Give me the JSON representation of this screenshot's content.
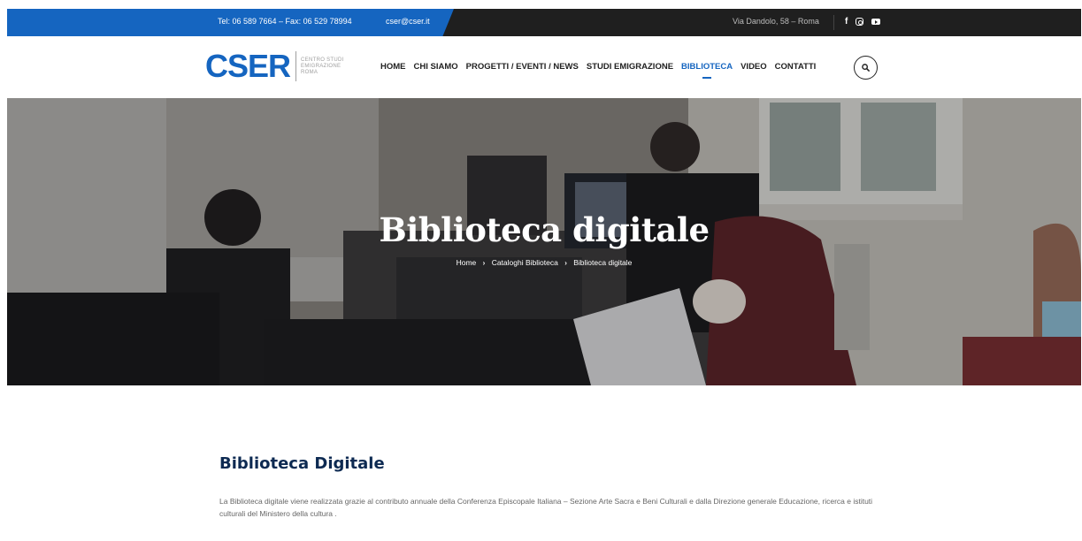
{
  "topbar": {
    "phone": "Tel: 06 589 7664 – Fax: 06 529 78994",
    "email": "cser@cser.it",
    "address": "Via Dandolo, 58 – Roma",
    "social": [
      "facebook-icon",
      "instagram-icon",
      "youtube-icon"
    ]
  },
  "logo": {
    "main": "CSER",
    "line1": "CENTRO STUDI",
    "line2": "EMIGRAZIONE",
    "line3": "ROMA"
  },
  "nav": {
    "items": [
      {
        "label": "HOME"
      },
      {
        "label": "CHI SIAMO"
      },
      {
        "label": "PROGETTI / EVENTI / NEWS"
      },
      {
        "label": "STUDI EMIGRAZIONE"
      },
      {
        "label": "BIBLIOTECA",
        "active": true
      },
      {
        "label": "VIDEO"
      },
      {
        "label": "CONTATTI"
      }
    ]
  },
  "hero": {
    "title": "Biblioteca digitale",
    "breadcrumb": [
      "Home",
      "Cataloghi Biblioteca",
      "Biblioteca digitale"
    ]
  },
  "content": {
    "title": "Biblioteca Digitale",
    "text": "La Biblioteca digitale viene realizzata grazie al contributo annuale della Conferenza Episcopale Italiana – Sezione Arte Sacra e Beni Culturali e  dalla Direzione generale Educazione, ricerca e istituti culturali del Ministero della cultura ."
  },
  "colors": {
    "brand_blue": "#1565c0",
    "topbar_dark": "#1f1f1f",
    "heading_navy": "#0d2a52"
  }
}
